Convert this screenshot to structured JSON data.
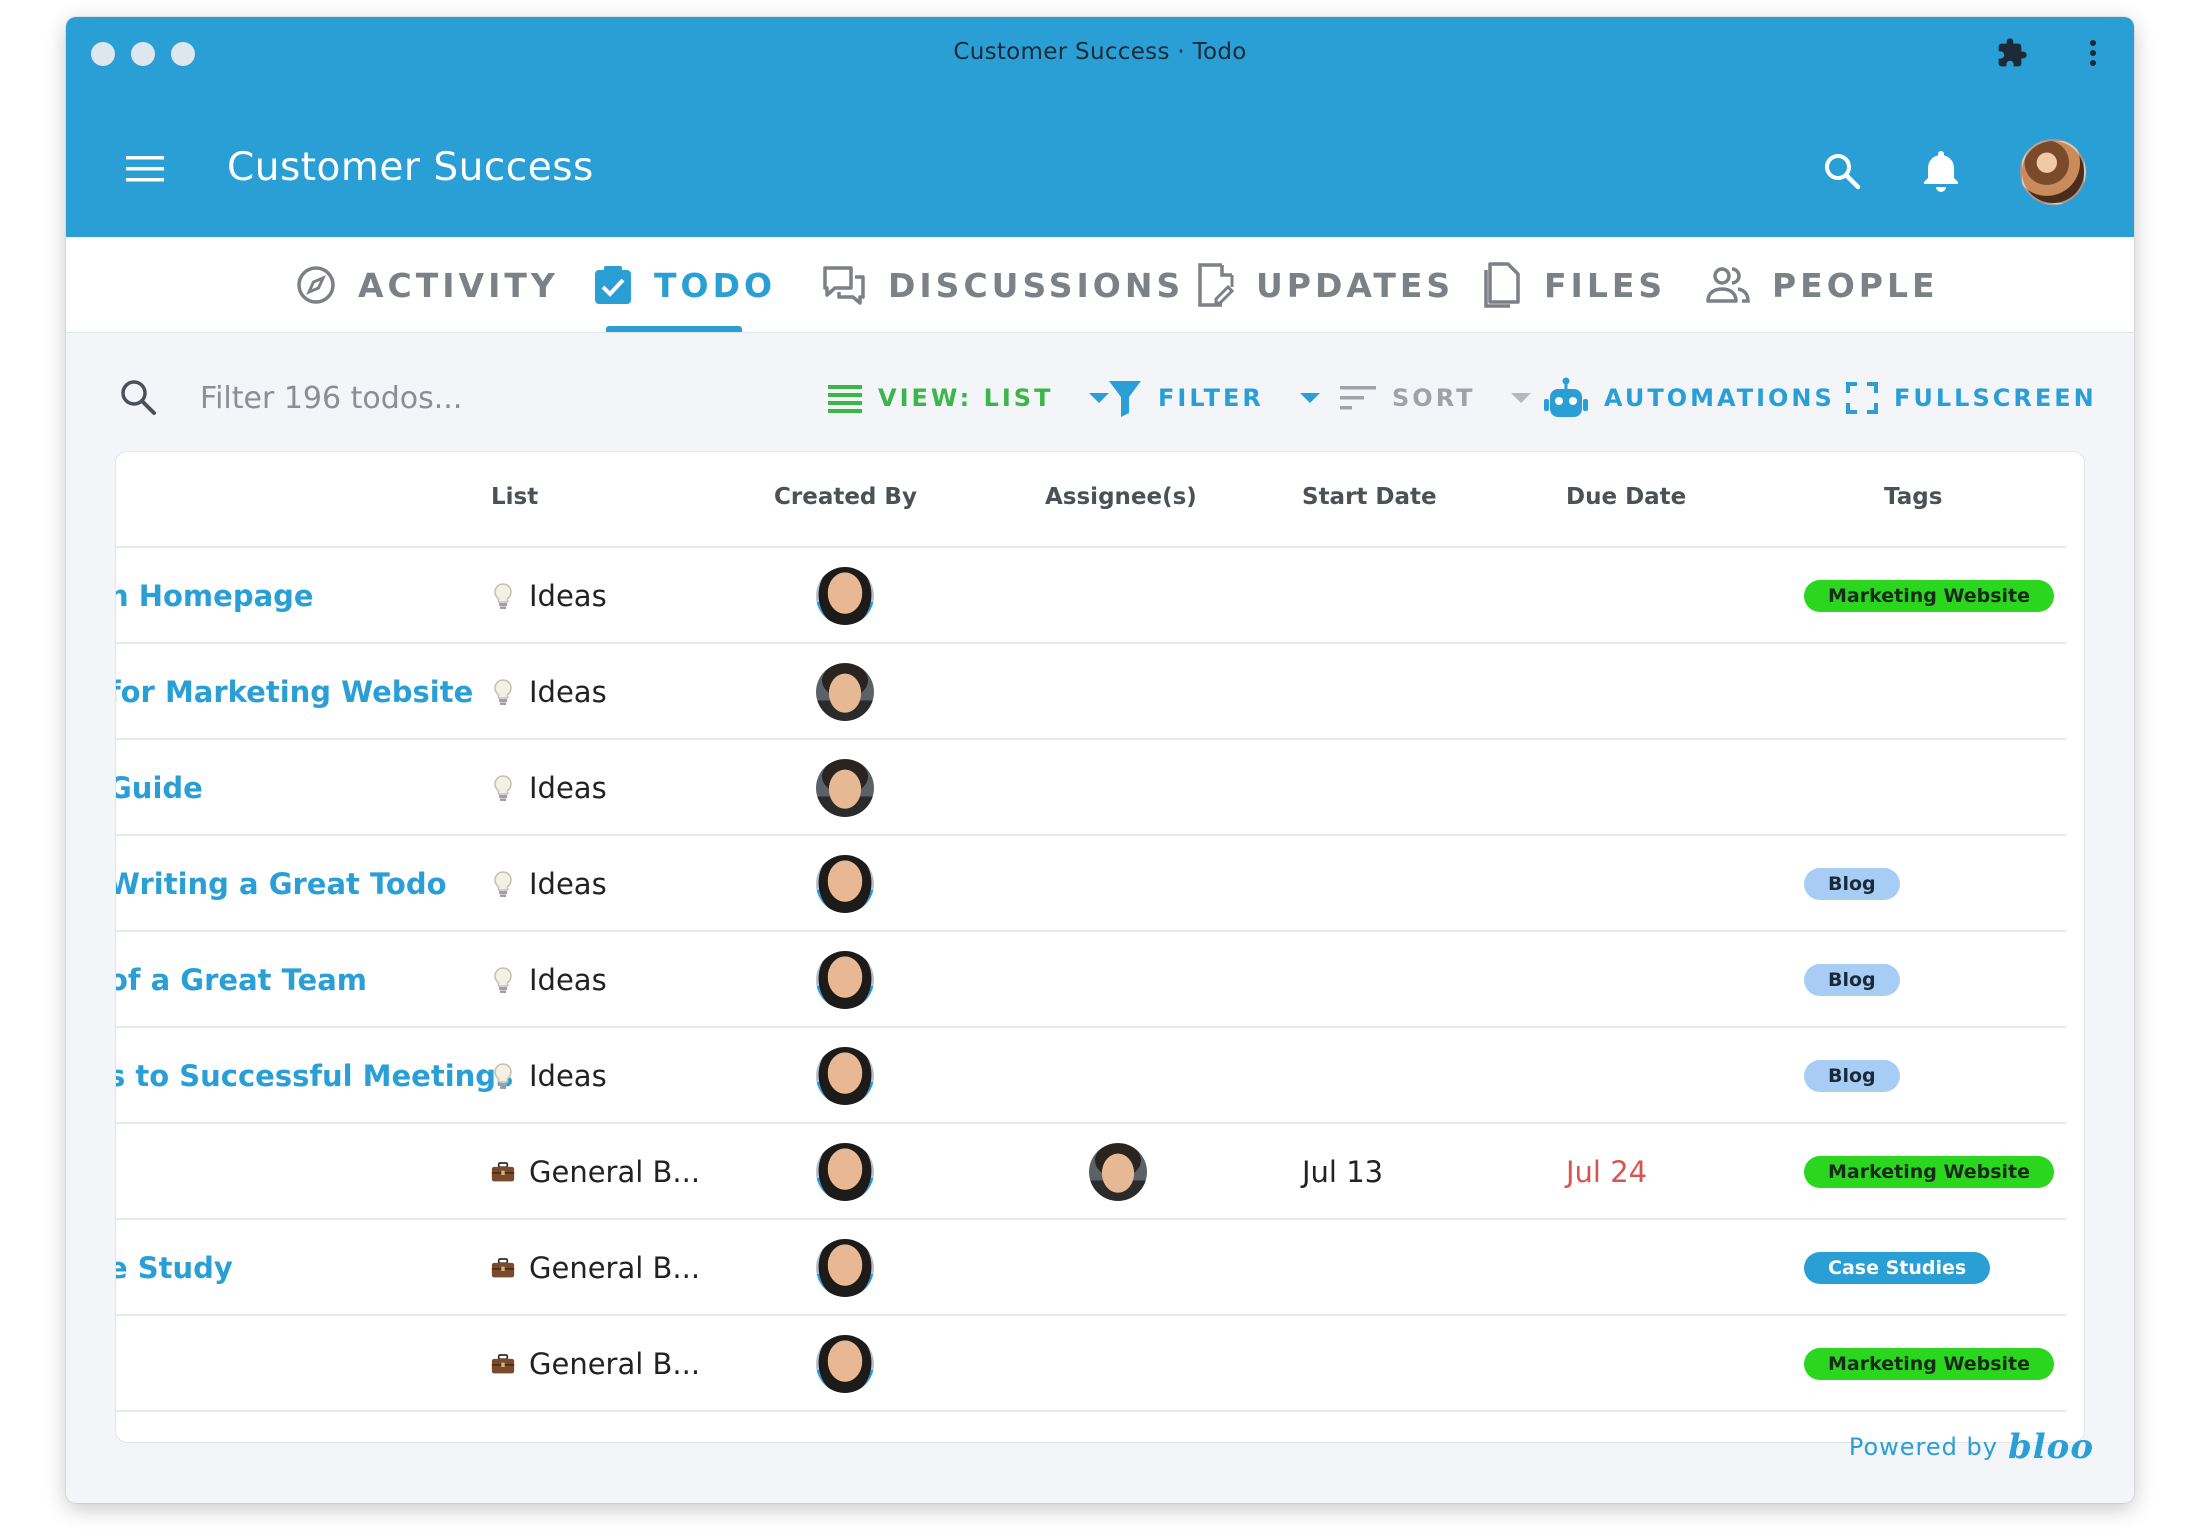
{
  "window": {
    "title": "Customer Success · Todo"
  },
  "header": {
    "title": "Customer Success"
  },
  "tabs": [
    {
      "label": "ACTIVITY",
      "icon": "compass-icon"
    },
    {
      "label": "TODO",
      "icon": "checkbox-icon",
      "active": true
    },
    {
      "label": "DISCUSSIONS",
      "icon": "chat-icon"
    },
    {
      "label": "UPDATES",
      "icon": "edit-doc-icon"
    },
    {
      "label": "FILES",
      "icon": "files-icon"
    },
    {
      "label": "PEOPLE",
      "icon": "people-icon"
    }
  ],
  "toolbar": {
    "filter_placeholder": "Filter 196 todos...",
    "view_label": "VIEW: LIST",
    "filter_label": "FILTER",
    "sort_label": "SORT",
    "automations_label": "AUTOMATIONS",
    "fullscreen_label": "FULLSCREEN"
  },
  "table": {
    "columns": [
      "List",
      "Created By",
      "Assignee(s)",
      "Start Date",
      "Due Date",
      "Tags"
    ],
    "rows": [
      {
        "title": "n Homepage",
        "list": "Ideas",
        "list_icon": "lightbulb-icon",
        "creator": "a",
        "assignee": "",
        "start": "",
        "due": "",
        "tag": "Marketing Website",
        "tag_color": "green"
      },
      {
        "title": "for Marketing Website",
        "list": "Ideas",
        "list_icon": "lightbulb-icon",
        "creator": "b",
        "assignee": "",
        "start": "",
        "due": "",
        "tag": "",
        "tag_color": ""
      },
      {
        "title": "Guide",
        "list": "Ideas",
        "list_icon": "lightbulb-icon",
        "creator": "b",
        "assignee": "",
        "start": "",
        "due": "",
        "tag": "",
        "tag_color": ""
      },
      {
        "title": "Writing a Great Todo",
        "list": "Ideas",
        "list_icon": "lightbulb-icon",
        "creator": "a",
        "assignee": "",
        "start": "",
        "due": "",
        "tag": "Blog",
        "tag_color": "lightblue"
      },
      {
        "title": "of a Great Team",
        "list": "Ideas",
        "list_icon": "lightbulb-icon",
        "creator": "a",
        "assignee": "",
        "start": "",
        "due": "",
        "tag": "Blog",
        "tag_color": "lightblue"
      },
      {
        "title": "s to Successful Meetings",
        "list": "Ideas",
        "list_icon": "lightbulb-icon",
        "creator": "a",
        "assignee": "",
        "start": "",
        "due": "",
        "tag": "Blog",
        "tag_color": "lightblue"
      },
      {
        "title": "",
        "list": "General B...",
        "list_icon": "briefcase-icon",
        "creator": "a",
        "assignee": "b",
        "start": "Jul 13",
        "due": "Jul 24",
        "tag": "Marketing Website",
        "tag_color": "green"
      },
      {
        "title": "e Study",
        "list": "General B...",
        "list_icon": "briefcase-icon",
        "creator": "a",
        "assignee": "",
        "start": "",
        "due": "",
        "tag": "Case Studies",
        "tag_color": "blue"
      },
      {
        "title": "",
        "list": "General B...",
        "list_icon": "briefcase-icon",
        "creator": "a",
        "assignee": "",
        "start": "",
        "due": "",
        "tag": "Marketing Website",
        "tag_color": "green"
      }
    ]
  },
  "footer": {
    "powered_text": "Powered by",
    "brand": "bloo"
  },
  "colors": {
    "accent": "#2a9fd6",
    "tag_green": "#2ad61e",
    "tag_lightblue": "#a7cdf5",
    "overdue": "#d9534f",
    "view_green": "#3cb54a"
  }
}
